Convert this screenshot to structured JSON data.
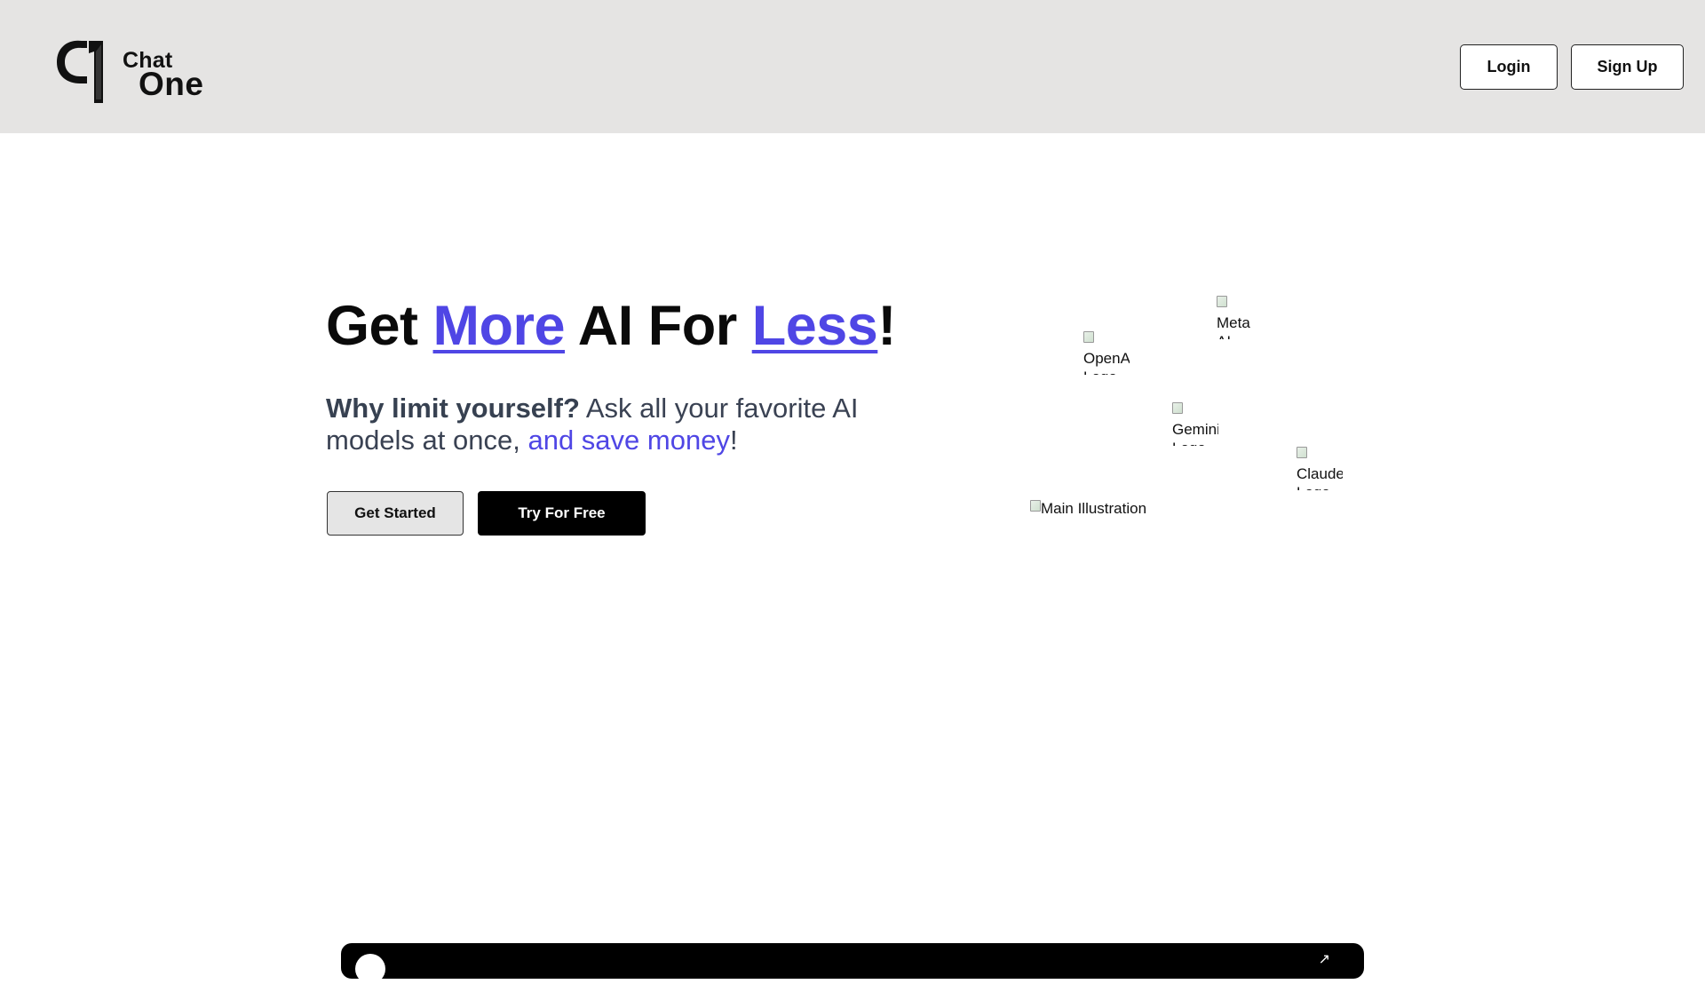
{
  "header": {
    "logo": {
      "chat": "Chat",
      "one": "One",
      "icon": "chatone-c1-logo-icon"
    },
    "login_label": "Login",
    "signup_label": "Sign Up"
  },
  "hero": {
    "title": {
      "part1": "Get ",
      "more": "More",
      "part2": " AI For ",
      "less": "Less",
      "part3": "!"
    },
    "subtitle": {
      "strong": "Why limit yourself?",
      "part1": " Ask all your favorite AI models at once, ",
      "accent": "and save money",
      "part2": "!"
    },
    "get_started_label": "Get Started",
    "try_free_label": "Try For Free"
  },
  "illustration": {
    "meta_alt": "Meta AI",
    "openai_alt": "OpenAI Logo",
    "gemini_alt": "Gemini Logo",
    "claude_alt": "Claude Logo",
    "main_alt": "Main Illustration"
  },
  "colors": {
    "accent": "#4f46e5",
    "header_bg": "#e5e4e3",
    "text_dark": "#0a0a0a",
    "subtitle": "#3a4253"
  }
}
